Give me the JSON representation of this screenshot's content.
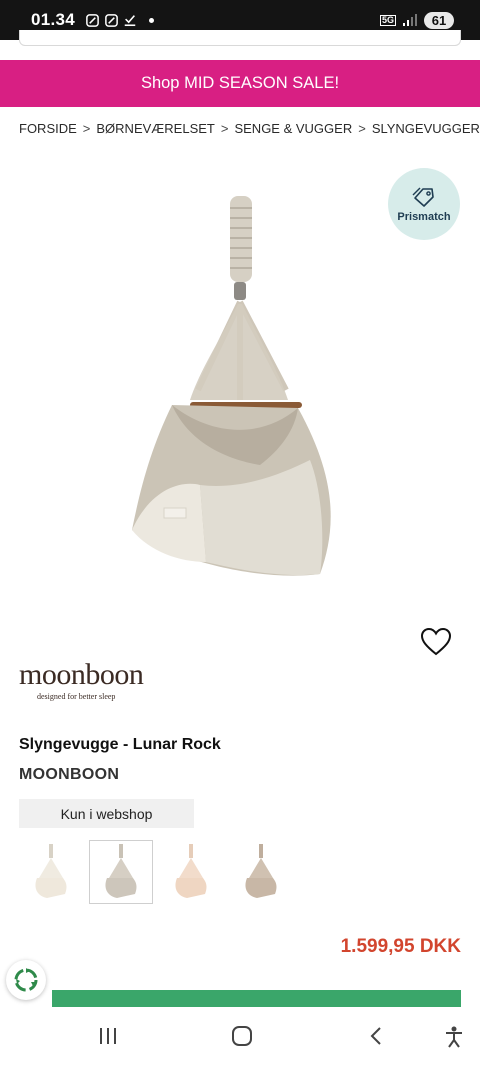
{
  "status_bar": {
    "time": "01.34",
    "network": "5G",
    "battery": "61"
  },
  "banner": {
    "text": "Shop MID SEASON SALE!",
    "color": "#d81f83"
  },
  "breadcrumb": {
    "items": [
      "FORSIDE",
      "BØRNEVÆRELSET",
      "SENGE & VUGGER",
      "SLYNGEVUGGER"
    ],
    "separator": ">"
  },
  "prismatch": {
    "label": "Prismatch",
    "icon": "price-tag-icon"
  },
  "brand_logo": {
    "word": "moonboon",
    "tagline": "designed for better sleep"
  },
  "product": {
    "title": "Slyngevugge - Lunar Rock",
    "brand": "MOONBOON",
    "availability": "Kun i webshop",
    "price": "1.599,95 DKK",
    "price_color": "#d2452e"
  },
  "variants": [
    {
      "name": "cream",
      "color": "#efe8dc",
      "selected": false
    },
    {
      "name": "lunar-rock",
      "color": "#cdc6bb",
      "selected": true
    },
    {
      "name": "peach",
      "color": "#efd6c2",
      "selected": false
    },
    {
      "name": "taupe",
      "color": "#c8b7a6",
      "selected": false
    }
  ],
  "cta": {
    "color": "#3aa66a"
  },
  "nav": {
    "icons": [
      "recent-apps-icon",
      "home-icon",
      "back-icon",
      "accessibility-icon"
    ]
  }
}
